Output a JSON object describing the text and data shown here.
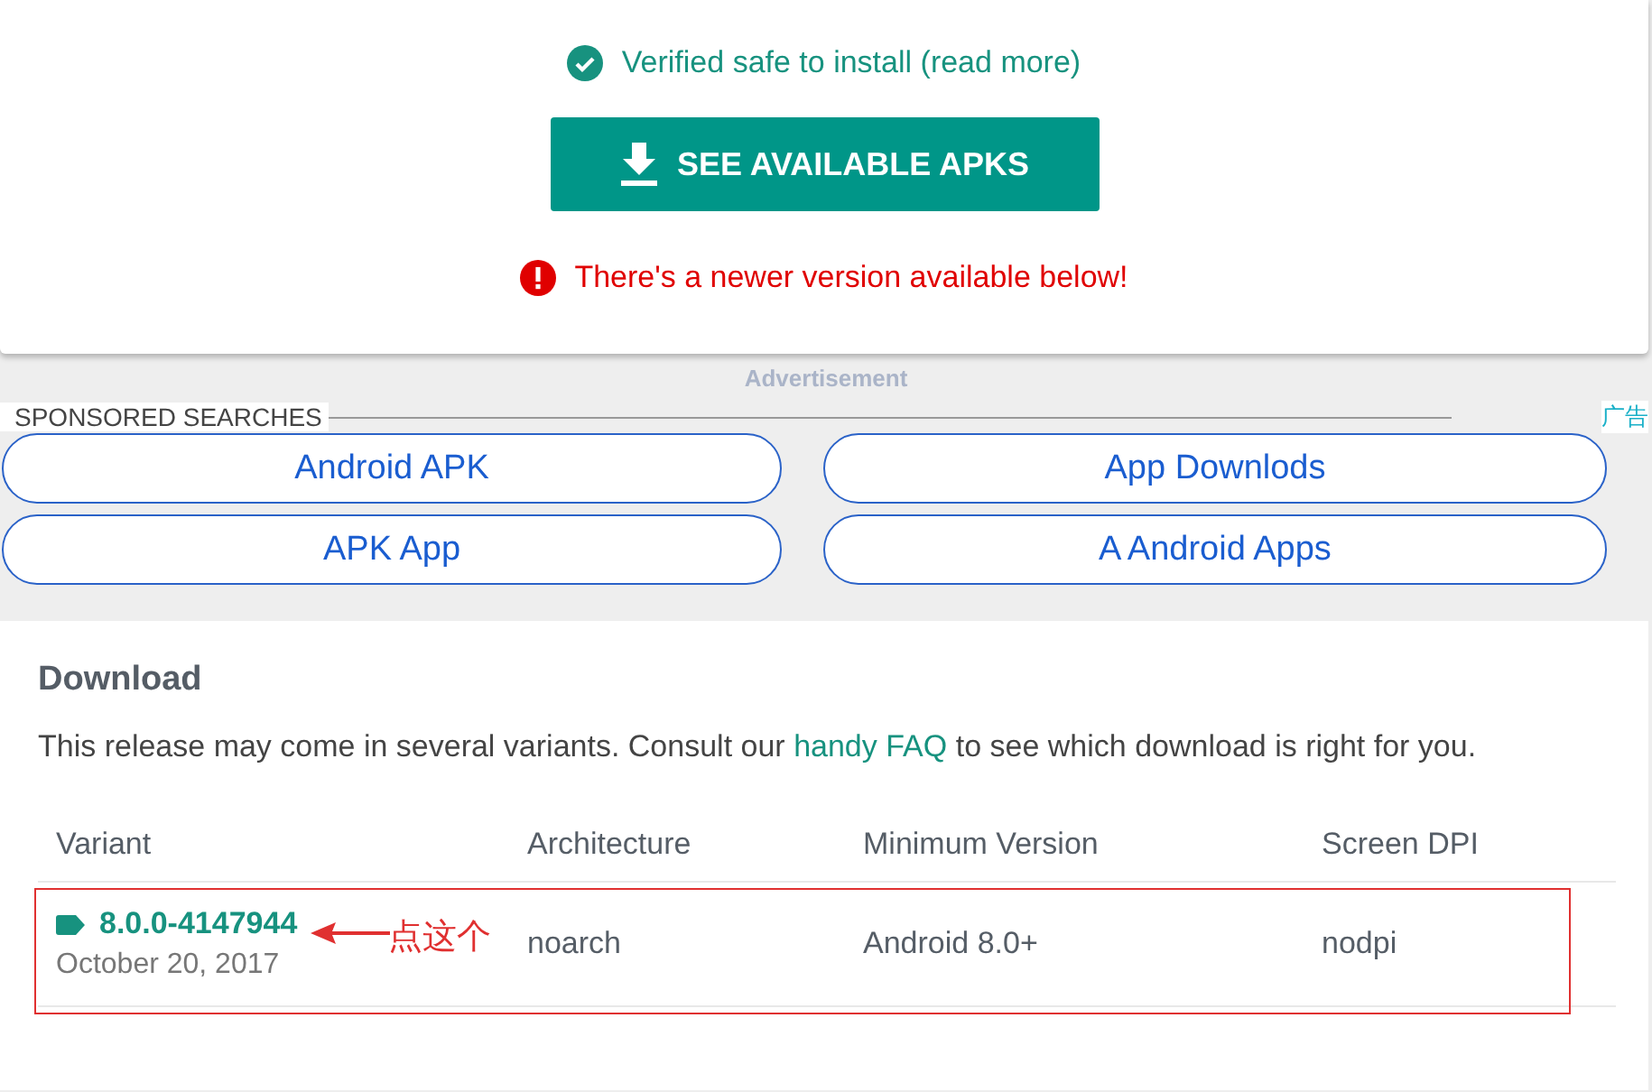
{
  "verified": {
    "text": "Verified safe to install",
    "link": "(read more)"
  },
  "download_button": {
    "label": "SEE AVAILABLE APKS"
  },
  "warning": {
    "text": "There's a newer version available below!"
  },
  "ad_label": "Advertisement",
  "sponsored": {
    "heading": "SPONSORED SEARCHES",
    "ad_mark": "广告",
    "links": [
      {
        "label": "Android APK"
      },
      {
        "label": "App Downlods"
      },
      {
        "label": "APK App"
      },
      {
        "label": "A Android Apps"
      }
    ]
  },
  "download": {
    "title": "Download",
    "intro_before": "This release may come in several variants. Consult our ",
    "intro_link": "handy FAQ",
    "intro_after": " to see which download is right for you.",
    "columns": [
      "Variant",
      "Architecture",
      "Minimum Version",
      "Screen DPI"
    ],
    "rows": [
      {
        "variant": "8.0.0-4147944",
        "date": "October 20, 2017",
        "architecture": "noarch",
        "min_version": "Android 8.0+",
        "dpi": "nodpi"
      }
    ]
  },
  "annotation": {
    "text": "点这个"
  }
}
